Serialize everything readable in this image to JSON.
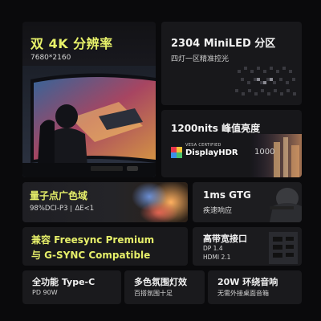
{
  "dual_4k": {
    "title": "双 4K 分辨率",
    "resolution": "7680*2160"
  },
  "miniled": {
    "title": "2304 MiniLED 分区",
    "subtitle": "四灯一区精准控光"
  },
  "brightness": {
    "title": "1200nits 峰值亮度",
    "logo_top": "VESA CERTIFIED",
    "logo_main": "DisplayHDR",
    "logo_value": "1000"
  },
  "quantum": {
    "title": "量子点广色域",
    "dci": "98%DCI-P3",
    "delta": "ΔE<1"
  },
  "gtg": {
    "title": "1ms GTG",
    "subtitle": "疾速响应"
  },
  "sync": {
    "line1": "兼容 Freesync Premium",
    "line2": "与 G-SYNC Compatible"
  },
  "ports": {
    "title": "高带宽接口",
    "dp": "DP 1.4",
    "hdmi": "HDMI 2.1"
  },
  "typec": {
    "title": "全功能 Type-C",
    "subtitle": "PD 90W"
  },
  "lights": {
    "title": "多色氛围灯效",
    "subtitle": "百搭氛围十足"
  },
  "audio": {
    "title": "20W 环绕音响",
    "subtitle": "无需外接桌面音箱"
  },
  "colors": {
    "accent": "#e6ef6a",
    "background": "#0a0a0c",
    "card": "#1a1a1d"
  }
}
